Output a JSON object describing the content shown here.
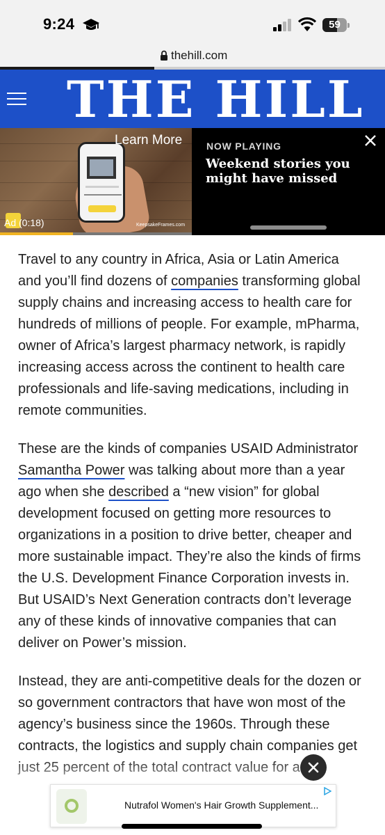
{
  "status_bar": {
    "time": "9:24",
    "battery": "59",
    "battery_level": 0.59,
    "icons": [
      "graduation-cap-icon",
      "cellular-signal-icon",
      "wifi-icon",
      "battery-icon"
    ]
  },
  "browser": {
    "url": "thehill.com",
    "load_progress": 0.4
  },
  "header": {
    "logo": "THE HILL",
    "menu_icon": "hamburger-menu-icon",
    "background": "#1d50c8"
  },
  "video": {
    "learn_more": "Learn More",
    "ad_time": "Ad (0:18)",
    "brand": "KeepsakeFrames.com",
    "now_playing": "NOW PLAYING",
    "title": "Weekend stories you might have missed",
    "progress": 0.38
  },
  "article": {
    "p1": {
      "a": "Travel to any country in Africa, Asia or Latin America and you’ll find dozens of ",
      "link": "companies",
      "b": " transforming global supply chains and increasing access to health care for hundreds of millions of people. For example, mPharma, owner of Africa’s largest pharmacy network, is rapidly increasing access across the continent to health care professionals and life-saving medications, including in remote communities."
    },
    "p2": {
      "a": "These are the kinds of companies USAID Administrator ",
      "link1": "Samantha Power",
      "b": " was talking about more than a year ago when she ",
      "link2": "described",
      "c": " a “new vision” for global development focused on getting more resources to organizations in a position to drive better, cheaper and more sustainable impact. They’re also the kinds of firms the U.S. Development Finance Corporation invests in. But USAID’s Next Generation contracts don’t leverage any of these kinds of innovative companies that can deliver on Power’s mission."
    },
    "p3": "Instead, they are anti-competitive deals for the dozen or so government contractors that have won most of the agency’s business since the 1960s. Through these contracts, the logistics and supply chain companies get just 25 percent of the total contract value for any"
  },
  "bottom_ad": {
    "text": "Nutrafol Women's Hair Growth Supplement...",
    "product_label": "NUTRAFOL"
  }
}
